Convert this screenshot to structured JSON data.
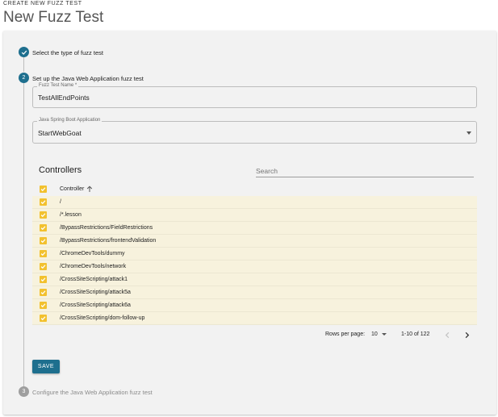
{
  "header": {
    "overline": "CREATE NEW FUZZ TEST",
    "title": "New Fuzz Test"
  },
  "steps": [
    {
      "label": "Select the type of fuzz test",
      "state": "completed",
      "icon": "check-icon"
    },
    {
      "number": "2",
      "label": "Set up the Java Web Application fuzz test",
      "state": "active"
    },
    {
      "number": "3",
      "label": "Configure the Java Web Application fuzz test",
      "state": "inactive"
    }
  ],
  "form": {
    "name_field": {
      "label": "Fuzz Test Name *",
      "value": "TestAllEndPoints"
    },
    "app_field": {
      "label": "Java Spring Boot Application",
      "value": "StartWebGoat"
    }
  },
  "controllers": {
    "title": "Controllers",
    "search_placeholder": "Search",
    "column_header": "Controller",
    "sort": "ascending",
    "rows": [
      "/",
      "/*.lesson",
      "/BypassRestrictions/FieldRestrictions",
      "/BypassRestrictions/frontendValidation",
      "/ChromeDevTools/dummy",
      "/ChromeDevTools/network",
      "/CrossSiteScripting/attack1",
      "/CrossSiteScripting/attack5a",
      "/CrossSiteScripting/attack6a",
      "/CrossSiteScripting/dom-follow-up"
    ],
    "all_checked": true
  },
  "pagination": {
    "rows_per_page_label": "Rows per page:",
    "rows_per_page_value": "10",
    "range": "1-10 of 122"
  },
  "actions": {
    "save_label": "SAVE"
  },
  "colors": {
    "accent": "#1e6f8e",
    "checkbox": "#f2c12e",
    "row_highlight": "#f7f2dd",
    "panel": "#f2f2f2"
  }
}
